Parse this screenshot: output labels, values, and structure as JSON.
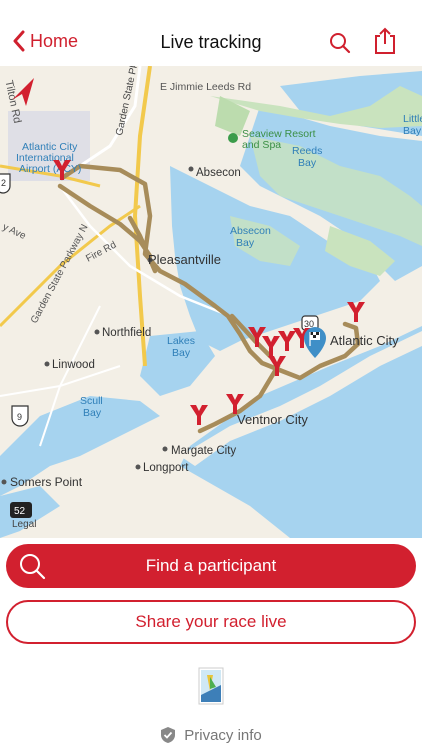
{
  "header": {
    "back_label": "Home",
    "title": "Live tracking"
  },
  "map": {
    "labels": {
      "tilton_rd": "Tilton Rd",
      "garden_state_pkwy": "Garden State Pkwy",
      "jimmie_leeds": "E Jimmie Leeds Rd",
      "airport": "Atlantic City\nInternational\nAirport (ACY)",
      "seaview": "Seaview Resort\nand Spa",
      "reeds_bay": "Reeds\nBay",
      "little_bay": "Little\nBay",
      "absecon": "Absecon",
      "absecon_bay": "Absecon\nBay",
      "ave": "y Ave",
      "fire_rd": "Fire Rd",
      "gsp_n": "Garden State Parkway N",
      "pleasantville": "Pleasantville",
      "northfield": "Northfield",
      "lakes_bay": "Lakes\nBay",
      "atlantic_city": "Atlantic City",
      "linwood": "Linwood",
      "scull_bay": "Scull\nBay",
      "ventnor": "Ventnor City",
      "margate": "Margate City",
      "longport": "Longport",
      "somers_point": "Somers Point",
      "legal": "Legal",
      "shield_9": "9",
      "shield_2": "2",
      "shield_30": "30",
      "shield_52": "52"
    },
    "route_color": "#a78c5a",
    "marker_color": "#d2202f"
  },
  "actions": {
    "find_participant": "Find a participant",
    "share_race": "Share your race live"
  },
  "footer": {
    "privacy": "Privacy info"
  }
}
